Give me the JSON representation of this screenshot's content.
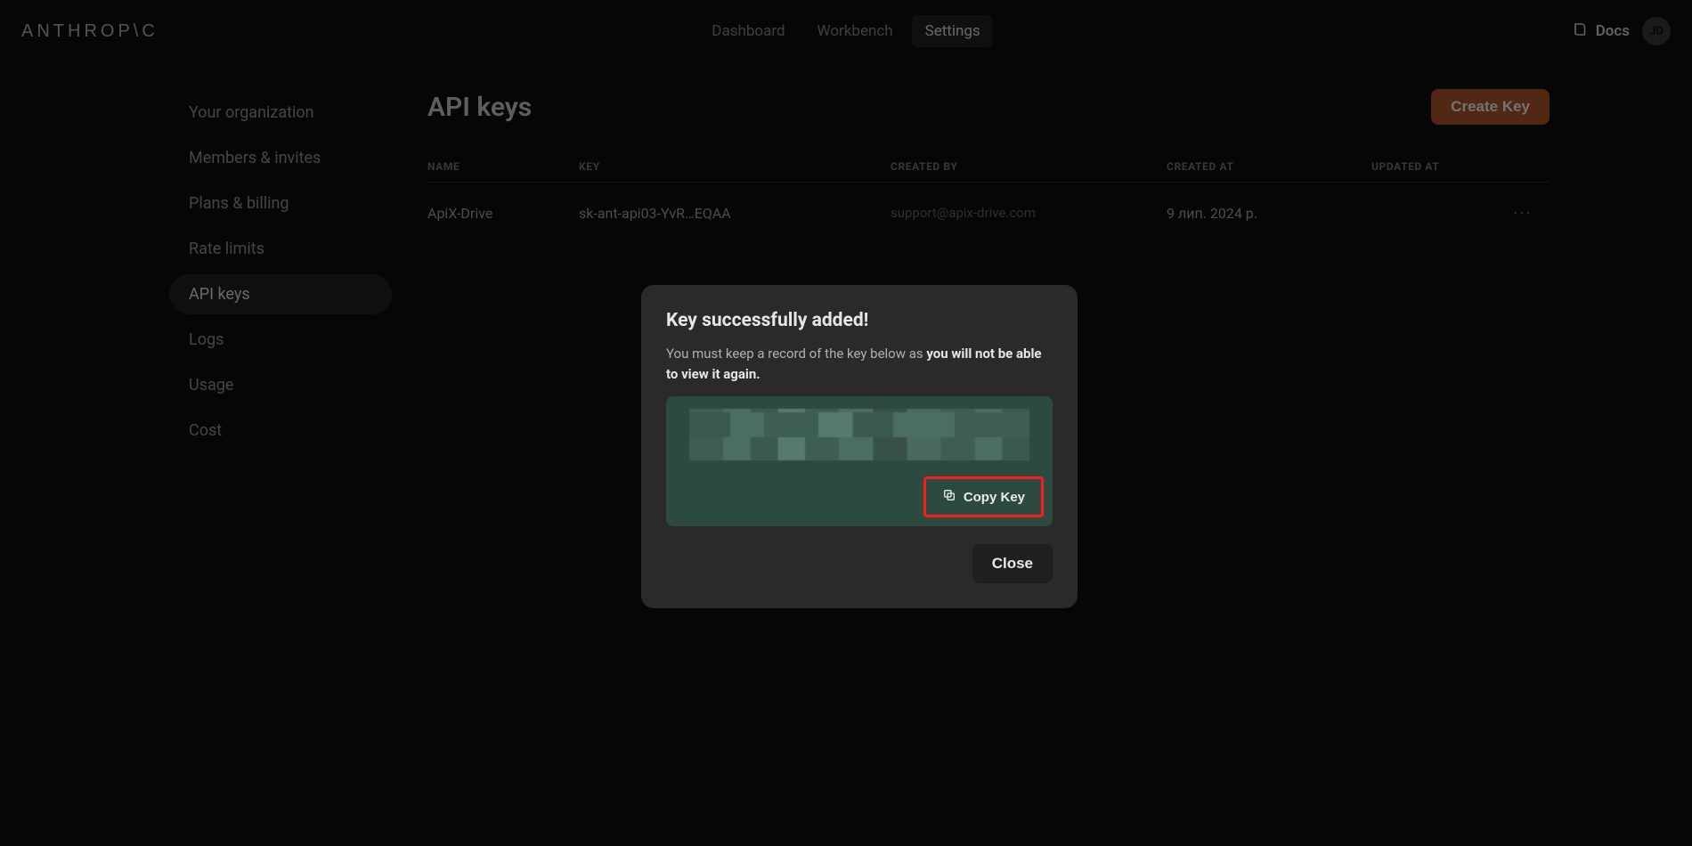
{
  "brand": "ANTHROP\\C",
  "nav": {
    "items": [
      "Dashboard",
      "Workbench",
      "Settings"
    ],
    "activeIndex": 2,
    "docs": "Docs",
    "avatar": "JD"
  },
  "sidebar": {
    "items": [
      "Your organization",
      "Members & invites",
      "Plans & billing",
      "Rate limits",
      "API keys",
      "Logs",
      "Usage",
      "Cost"
    ],
    "activeIndex": 4
  },
  "page": {
    "title": "API keys",
    "create_btn": "Create Key"
  },
  "table": {
    "headers": [
      "NAME",
      "KEY",
      "CREATED BY",
      "CREATED AT",
      "UPDATED AT"
    ],
    "rows": [
      {
        "name": "ApiX-Drive",
        "key": "sk-ant-api03-YvR…EQAA",
        "created_by": "support@apix-drive.com",
        "created_at": "9 лип. 2024 р.",
        "updated_at": ""
      }
    ]
  },
  "modal": {
    "title": "Key successfully added!",
    "sub_pre": "You must keep a record of the key below as ",
    "sub_strong": "you will not be able to view it again.",
    "copy_btn": "Copy Key",
    "close_btn": "Close"
  }
}
